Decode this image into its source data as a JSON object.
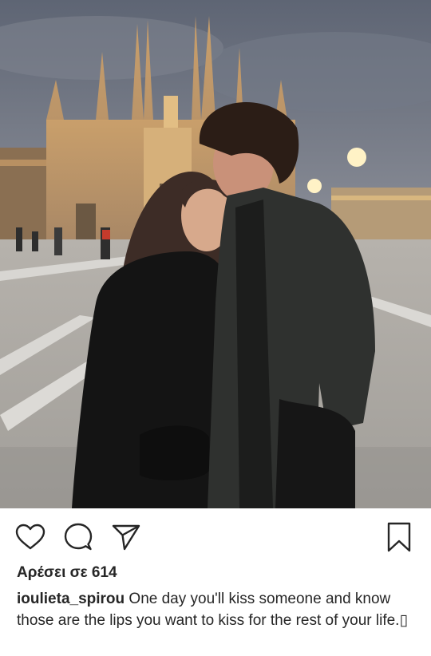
{
  "post": {
    "image_alt": "",
    "likes_label": "Αρέσει σε 614",
    "username": "ioulieta_spirou",
    "caption_text": " One day you'll kiss someone and know those are the lips you want to kiss for the rest of your life.▯"
  },
  "actions": {
    "like_icon": "heart-icon",
    "comment_icon": "comment-bubble-icon",
    "share_icon": "paper-plane-icon",
    "save_icon": "bookmark-icon"
  },
  "colors": {
    "icon": "#262626",
    "text": "#262626",
    "background": "#ffffff"
  }
}
